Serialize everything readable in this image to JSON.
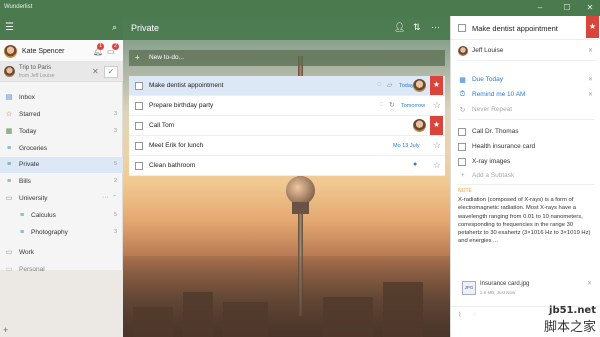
{
  "app": {
    "title": "Wunderlist"
  },
  "sidebar": {
    "user_name": "Kate Spencer",
    "notifications_count": "1",
    "conversations_count": "2",
    "share": {
      "title": "Trip to Paris",
      "from": "from Jeff Louise"
    },
    "lists": [
      {
        "label": "Inbox",
        "icon": "inbox-icon",
        "count": ""
      },
      {
        "label": "Starred",
        "icon": "star-icon",
        "count": "3"
      },
      {
        "label": "Today",
        "icon": "calendar-icon",
        "count": "3"
      },
      {
        "label": "Groceries",
        "icon": "list-icon",
        "count": ""
      },
      {
        "label": "Private",
        "icon": "list-icon",
        "count": "5"
      },
      {
        "label": "Bills",
        "icon": "list-icon",
        "count": "2"
      },
      {
        "label": "University",
        "icon": "folder-icon",
        "count": ""
      },
      {
        "label": "Calculus",
        "icon": "list-icon",
        "count": "5"
      },
      {
        "label": "Photography",
        "icon": "list-icon",
        "count": "3"
      },
      {
        "label": "Work",
        "icon": "folder-icon",
        "count": ""
      },
      {
        "label": "Personal",
        "icon": "folder-icon",
        "count": ""
      }
    ]
  },
  "main": {
    "title": "Private",
    "add_placeholder": "New to-do...",
    "tasks": [
      {
        "label": "Make dentist appointment",
        "due": "Today",
        "starred": true
      },
      {
        "label": "Prepare birthday party",
        "due": "Tomorrow",
        "starred": false
      },
      {
        "label": "Call Tom",
        "due": "",
        "starred": true
      },
      {
        "label": "Meet Erik for lunch",
        "due": "Mo 13 July",
        "starred": false
      },
      {
        "label": "Clean bathroom",
        "due": "",
        "starred": false
      }
    ]
  },
  "detail": {
    "title": "Make dentist appointment",
    "assignee": "Jeff Louise",
    "due": "Due Today",
    "reminder": "Remind me 10 AM",
    "repeat": "Never Repeat",
    "subtasks": [
      "Call Dr. Thomas",
      "Health insurance card",
      "X-ray images"
    ],
    "add_subtask": "Add a Subtask",
    "note_label": "NOTE",
    "note": "X-radiation (composed of X-rays) is a form of electromagnetic radiation. Most X-rays have a wavelength ranging from 0.01 to 10 nanometers, corresponding to frequencies in the range 30 petahertz to 30 exahertz (3×1016 Hz to 3×1019 Hz) and energies ...",
    "file": {
      "name": "Insurance card.jpg",
      "type": "JPG",
      "size": "2.6 MB, Just Now"
    }
  },
  "watermark": {
    "line1": "jb51.net",
    "line2": "脚本之家"
  },
  "colors": {
    "header": "#4a7a4e",
    "selected": "#dce8f5",
    "flag": "#d9453b",
    "due": "#2d7bd4"
  }
}
